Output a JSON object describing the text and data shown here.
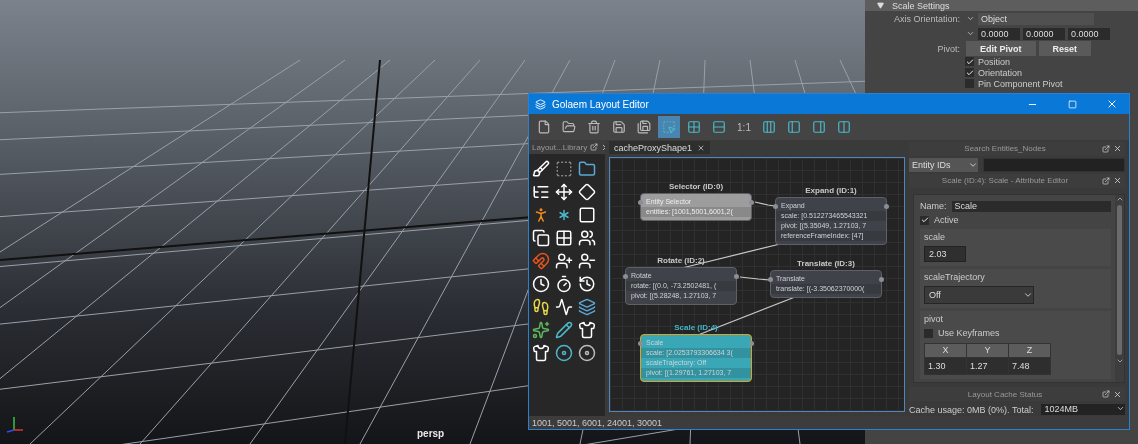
{
  "viewport": {
    "camera_label": "persp"
  },
  "attribute_panel": {
    "section_title": "Scale Settings",
    "axis_orientation_label": "Axis Orientation:",
    "axis_orientation_value": "Object",
    "offset_values": [
      "0.0000",
      "0.0000",
      "0.0000"
    ],
    "pivot_label": "Pivot:",
    "pivot_buttons": [
      "Edit Pivot",
      "Reset"
    ],
    "checkboxes": [
      {
        "label": "Position",
        "checked": true
      },
      {
        "label": "Orientation",
        "checked": true
      },
      {
        "label": "Pin Component Pivot",
        "checked": false
      }
    ]
  },
  "layout_editor": {
    "title": "Golaem Layout Editor",
    "toolbar": [
      {
        "kind": "icon",
        "selected": false
      },
      {
        "kind": "icon",
        "selected": false
      },
      {
        "kind": "icon",
        "selected": false
      },
      {
        "kind": "icon",
        "selected": false
      },
      {
        "kind": "icon",
        "selected": false
      },
      {
        "kind": "icon",
        "selected": true
      },
      {
        "kind": "icon",
        "selected": false
      },
      {
        "kind": "icon",
        "selected": false
      },
      {
        "kind": "text",
        "label": "1:1",
        "selected": false
      },
      {
        "kind": "icon",
        "selected": false
      },
      {
        "kind": "icon",
        "selected": false
      },
      {
        "kind": "icon",
        "selected": false
      },
      {
        "kind": "icon",
        "selected": false
      }
    ],
    "library_panel": {
      "title": "Layout...Library"
    },
    "graph_tab": {
      "label": "cacheProxyShape1"
    },
    "nodes": [
      {
        "title": "Selector (ID:0)",
        "kind": "selector",
        "selected": false,
        "lines": [
          "Entity Selector",
          "entities: [1001,5001,6001,2("
        ]
      },
      {
        "title": "Expand (ID:1)",
        "kind": "operator",
        "selected": false,
        "lines": [
          "Expand",
          "scale: [0.512273465543321",
          "pivot: [(5.35049, 1.27103, 7",
          "referenceFrameIndex: [47]"
        ]
      },
      {
        "title": "Rotate (ID:2)",
        "kind": "operator",
        "selected": false,
        "lines": [
          "Rotate",
          "rotate: [(0.0, -73.2502481, (",
          "pivot: [(5.28248, 1.27103, 7"
        ]
      },
      {
        "title": "Translate (ID:3)",
        "kind": "operator",
        "selected": false,
        "lines": [
          "Translate",
          "translate: [(-3.35062370000("
        ]
      },
      {
        "title": "Scale (ID:4)",
        "kind": "operator",
        "selected": true,
        "lines": [
          "Scale",
          "scale: [2.0253793306634 3(",
          "scaleTrajectory: Off",
          "pivot: [(1.29761, 1.27103, 7"
        ]
      }
    ],
    "status_bar": "1001, 5001, 6001, 24001, 30001",
    "search_panel": {
      "title": "Search Entities_Nodes",
      "filter": "Entity IDs"
    },
    "attribute_editor": {
      "title": "Scale (ID:4): Scale - Attribute Editor",
      "name_label": "Name:",
      "name_value": "Scale",
      "active": {
        "label": "Active",
        "checked": true
      },
      "scale": {
        "label": "scale",
        "value": "2.03"
      },
      "scale_trajectory": {
        "label": "scaleTrajectory",
        "value": "Off"
      },
      "pivot": {
        "label": "pivot",
        "use_keyframes": {
          "label": "Use Keyframes",
          "checked": false
        },
        "columns": [
          "X",
          "Y",
          "Z"
        ],
        "values": [
          "1.30",
          "1.27",
          "7.48"
        ]
      }
    },
    "cache_status": {
      "title": "Layout Cache Status",
      "usage": "Cache usage: 0MB (0%). Total:",
      "total": "1024MB"
    }
  }
}
